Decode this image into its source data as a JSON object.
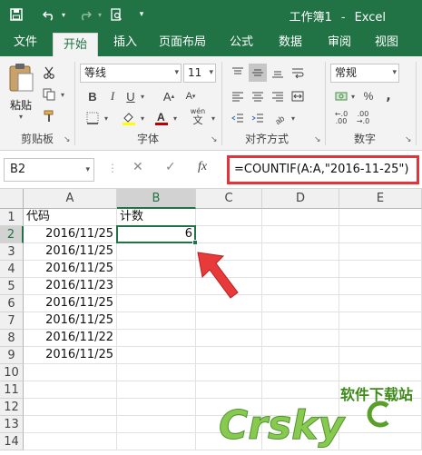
{
  "window": {
    "title": "工作簿1",
    "separator": "-",
    "app": "Excel"
  },
  "tabs": [
    "文件",
    "开始",
    "插入",
    "页面布局",
    "公式",
    "数据",
    "审阅",
    "视图"
  ],
  "active_tab": "开始",
  "ribbon": {
    "paste_label": "粘贴",
    "font_name": "等线",
    "font_size": "11",
    "number_format": "常规",
    "groups": {
      "clipboard": "剪贴板",
      "font": "字体",
      "alignment": "对齐方式",
      "number": "数字"
    },
    "wen_label": "wén",
    "wen_char": "文",
    "font_color": "#c00000",
    "highlight_color": "#ffff00"
  },
  "formula_bar": {
    "name_box": "B2",
    "cancel_icon": "✕",
    "enter_icon": "✓",
    "fx_label": "fx",
    "formula": "=COUNTIF(A:A,\"2016-11-25\")"
  },
  "grid": {
    "columns": [
      "A",
      "B",
      "C",
      "D",
      "E"
    ],
    "rows": [
      "1",
      "2",
      "3",
      "4",
      "5",
      "6",
      "7",
      "8",
      "9",
      "10",
      "11",
      "12",
      "13",
      "14"
    ],
    "selected_cell": "B2",
    "cells": {
      "A1": "代码",
      "B1": "计数",
      "A2": "2016/11/25",
      "B2": "6",
      "A3": "2016/11/25",
      "A4": "2016/11/25",
      "A5": "2016/11/23",
      "A6": "2016/11/25",
      "A7": "2016/11/25",
      "A8": "2016/11/22",
      "A9": "2016/11/25"
    }
  },
  "watermark": {
    "brand": "Crsky",
    "site": "软件下载站"
  }
}
